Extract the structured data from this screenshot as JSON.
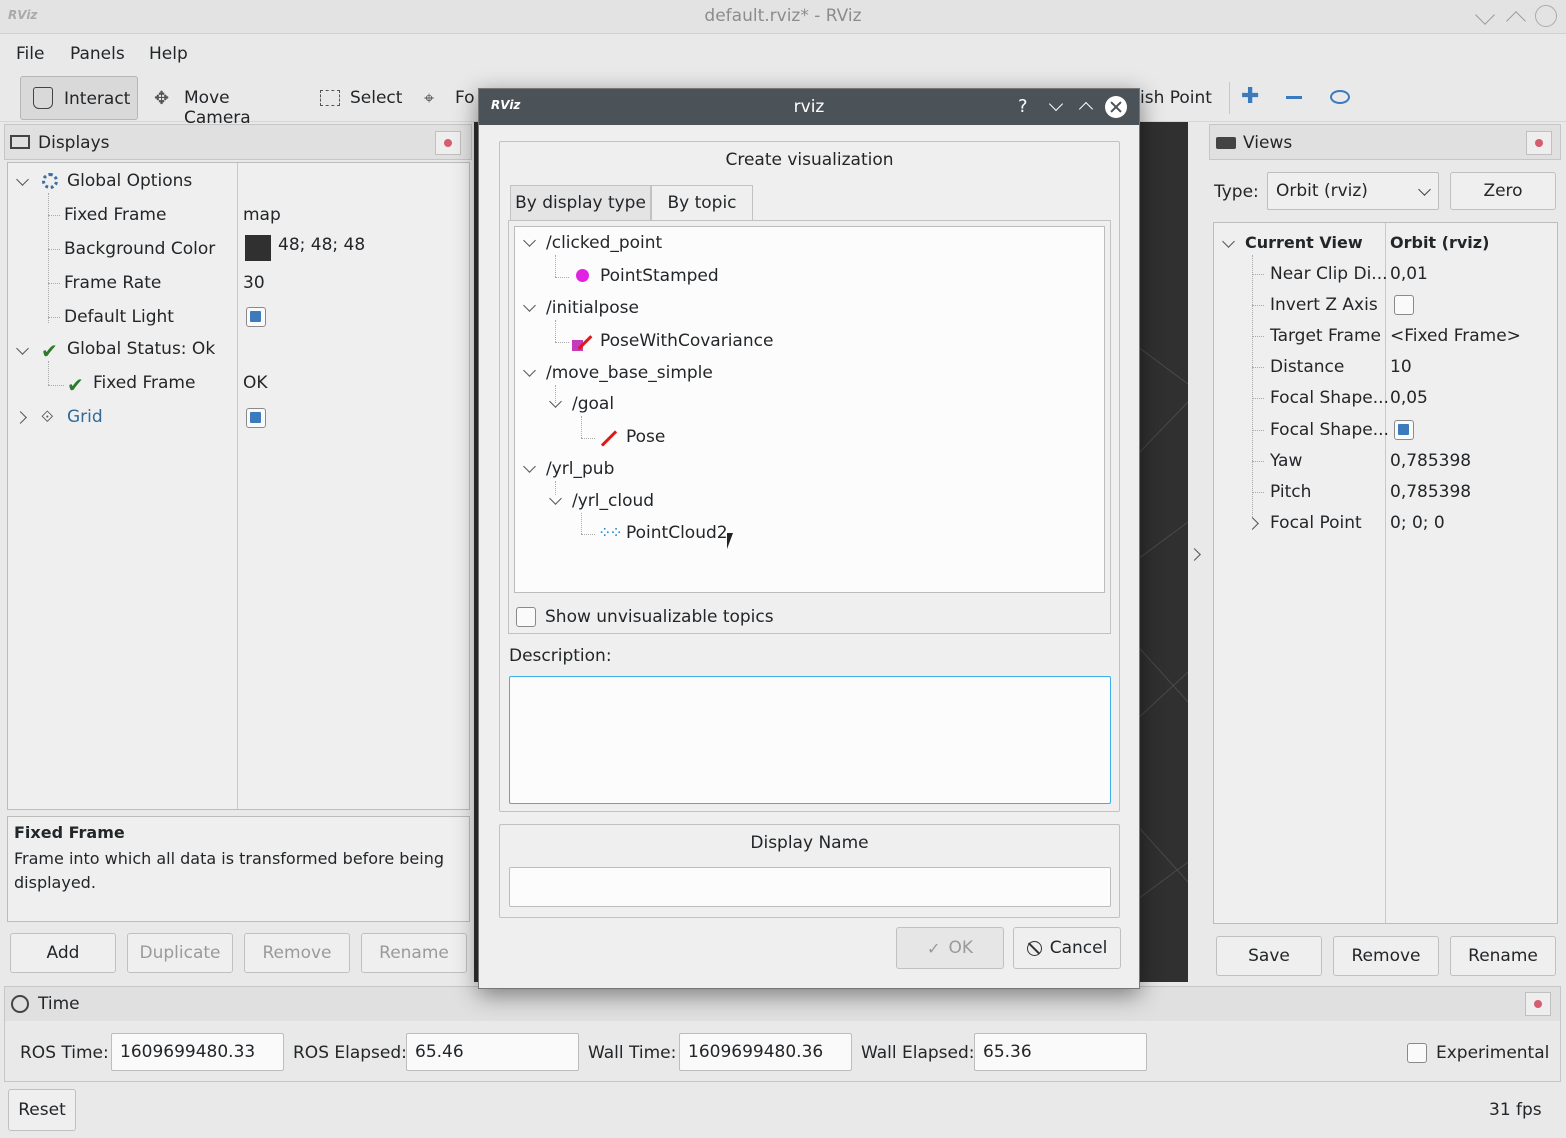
{
  "window": {
    "title": "default.rviz* - RViz"
  },
  "menu": {
    "file": "File",
    "panels": "Panels",
    "help": "Help"
  },
  "toolbar": {
    "interact": "Interact",
    "move_camera": "Move Camera",
    "select": "Select",
    "focus_partial": "Fo",
    "publish_point_partial": "ish Point"
  },
  "displays": {
    "title": "Displays",
    "rows": {
      "global_options": "Global Options",
      "fixed_frame": "Fixed Frame",
      "fixed_frame_val": "map",
      "bg_color": "Background Color",
      "bg_color_val": "48; 48; 48",
      "frame_rate": "Frame Rate",
      "frame_rate_val": "30",
      "default_light": "Default Light",
      "global_status": "Global Status: Ok",
      "status_fixed_frame": "Fixed Frame",
      "status_fixed_frame_val": "OK",
      "grid": "Grid"
    },
    "help_title": "Fixed Frame",
    "help_text": "Frame into which all data is transformed before being displayed.",
    "buttons": {
      "add": "Add",
      "duplicate": "Duplicate",
      "remove": "Remove",
      "rename": "Rename"
    }
  },
  "views": {
    "title": "Views",
    "type_label": "Type:",
    "type_value": "Orbit (rviz)",
    "zero": "Zero",
    "current_view": "Current View",
    "current_view_val": "Orbit (rviz)",
    "rows": [
      {
        "label": "Near Clip Di...",
        "value": "0,01"
      },
      {
        "label": "Invert Z Axis",
        "value": ""
      },
      {
        "label": "Target Frame",
        "value": "<Fixed Frame>"
      },
      {
        "label": "Distance",
        "value": "10"
      },
      {
        "label": "Focal Shape...",
        "value": "0,05"
      },
      {
        "label": "Focal Shape...",
        "value": ""
      },
      {
        "label": "Yaw",
        "value": "0,785398"
      },
      {
        "label": "Pitch",
        "value": "0,785398"
      },
      {
        "label": "Focal Point",
        "value": "0; 0; 0"
      }
    ],
    "buttons": {
      "save": "Save",
      "remove": "Remove",
      "rename": "Rename"
    }
  },
  "time": {
    "title": "Time",
    "ros_time_label": "ROS Time:",
    "ros_time": "1609699480.33",
    "ros_elapsed_label": "ROS Elapsed:",
    "ros_elapsed": "65.46",
    "wall_time_label": "Wall Time:",
    "wall_time": "1609699480.36",
    "wall_elapsed_label": "Wall Elapsed:",
    "wall_elapsed": "65.36",
    "experimental": "Experimental"
  },
  "status": {
    "reset": "Reset",
    "fps": "31 fps"
  },
  "dialog": {
    "title": "rviz",
    "help_btn": "?",
    "group_title": "Create visualization",
    "tab_display_type": "By display type",
    "tab_topic": "By topic",
    "tree": {
      "clicked_point": "/clicked_point",
      "point_stamped": "PointStamped",
      "initialpose": "/initialpose",
      "pose_cov": "PoseWithCovariance",
      "move_base_simple": "/move_base_simple",
      "goal": "/goal",
      "pose": "Pose",
      "yrl_pub": "/yrl_pub",
      "yrl_cloud": "/yrl_cloud",
      "pointcloud2": "PointCloud2"
    },
    "show_unvis": "Show unvisualizable topics",
    "description_label": "Description:",
    "description": "",
    "display_name_title": "Display Name",
    "display_name": "",
    "ok": "OK",
    "cancel": "Cancel"
  },
  "colors": {
    "accent": "#3daee9",
    "title_bar": "#4b5258",
    "viewport": "#303030",
    "grid_label": "#2f6a9a"
  }
}
